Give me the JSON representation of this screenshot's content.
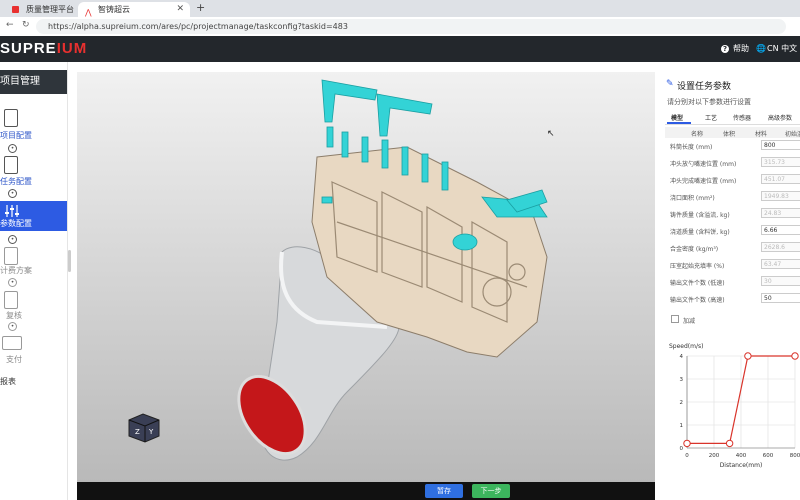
{
  "browser": {
    "tabs": [
      {
        "label": "质量管理平台"
      },
      {
        "label": "智铸超云"
      }
    ],
    "new_tab": "+",
    "url": "https://alpha.supreium.com/ares/pc/projectmanage/taskconfig?taskid=483"
  },
  "header": {
    "logo_pre": "SUPRE",
    "logo_post": "IUM",
    "help": "帮助",
    "lang": "CN 中文"
  },
  "sidebar": {
    "title": "项目管理",
    "steps": [
      {
        "label": "项目配置",
        "icon": "project-config-icon"
      },
      {
        "label": "任务配置",
        "icon": "task-config-icon"
      },
      {
        "label": "参数配置",
        "icon": "sliders-icon"
      },
      {
        "label": "计费方案",
        "icon": "billing-icon"
      },
      {
        "label": "复核",
        "icon": "review-icon"
      },
      {
        "label": "支付",
        "icon": "payment-icon"
      },
      {
        "label": "报表",
        "icon": "report-icon"
      }
    ]
  },
  "panel": {
    "title": "设置任务参数",
    "subtitle": "请分别对以下参数进行设置",
    "tabs": [
      "模型",
      "工艺",
      "传感器",
      "高级参数"
    ],
    "cols": [
      "名称",
      "体积",
      "材料",
      "初始温"
    ],
    "fields": [
      {
        "label": "料筒长度 (mm)",
        "value": "800",
        "editable": true
      },
      {
        "label": "冲头放勺嘴速位置 (mm)",
        "value": "315.73",
        "editable": false
      },
      {
        "label": "冲头完成嘴速位置 (mm)",
        "value": "451.07",
        "editable": false
      },
      {
        "label": "浇口面积 (mm²)",
        "value": "1949.83",
        "editable": false
      },
      {
        "label": "铸件质量 (含溢流, kg)",
        "value": "24.83",
        "editable": false
      },
      {
        "label": "浇道质量 (含料饼, kg)",
        "value": "6.66",
        "editable": true
      },
      {
        "label": "合金密度 (kg/m³)",
        "value": "2628.6",
        "editable": false
      },
      {
        "label": "压室起始充填率 (%)",
        "value": "63.47",
        "editable": false
      },
      {
        "label": "输出文件个数 (低速)",
        "value": "30",
        "editable": false
      },
      {
        "label": "输出文件个数 (高速)",
        "value": "50",
        "editable": true
      }
    ],
    "checkbox_label": "加减"
  },
  "bottom": {
    "save": "暂存",
    "next": "下一步"
  },
  "chart_data": {
    "type": "line",
    "title": "",
    "xlabel": "Distance(mm)",
    "ylabel": "Speed(m/s)",
    "xlim": [
      0,
      800
    ],
    "ylim": [
      0,
      4
    ],
    "xticks": [
      0,
      200,
      400,
      600,
      800
    ],
    "yticks": [
      0,
      1,
      2,
      3,
      4
    ],
    "grid": true,
    "series": [
      {
        "x": [
          0,
          315.73,
          451.07,
          800
        ],
        "y": [
          0.2,
          0.2,
          4,
          4
        ]
      }
    ],
    "color": "#d9342b"
  },
  "colors": {
    "accent": "#2d5be3",
    "brand_red": "#e8302f",
    "save": "#2f6fe0",
    "next": "#3cb55d"
  }
}
